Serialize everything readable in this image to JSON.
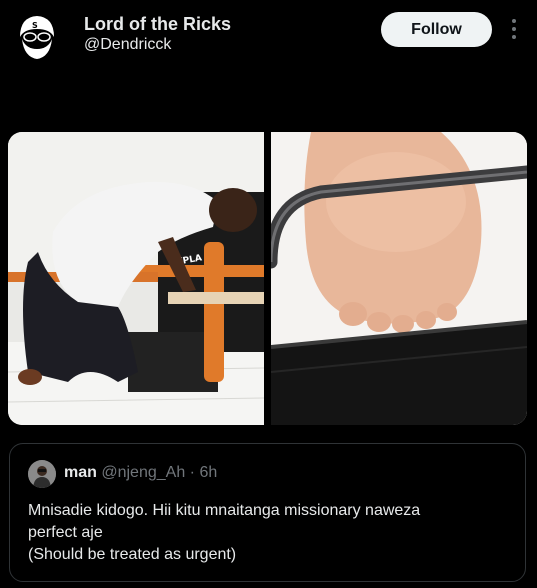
{
  "author": {
    "display_name": "Lord of the Ricks",
    "handle": "@Dendricck",
    "avatar_icon": "bearded-figure-avatar"
  },
  "actions": {
    "follow_label": "Follow",
    "more_icon": "vertical-ellipsis-icon"
  },
  "media": {
    "left_photo_label": "KYPLA",
    "left_photo_icon": "person-kneeling-at-bed-photo",
    "right_photo_icon": "foot-under-bed-rail-photo"
  },
  "quoted_post": {
    "display_name": "man",
    "handle": "@njeng_Ah",
    "separator": "·",
    "time": "6h",
    "text_lines": [
      "Mnisadie kidogo. Hii kitu mnaitanga missionary naweza",
      "perfect aje",
      "(Should be treated as urgent)"
    ]
  },
  "colors": {
    "background": "#000000",
    "text_primary": "#e7e9ea",
    "text_secondary": "#71767b",
    "border": "#2f3336",
    "follow_bg": "#eff3f4"
  }
}
